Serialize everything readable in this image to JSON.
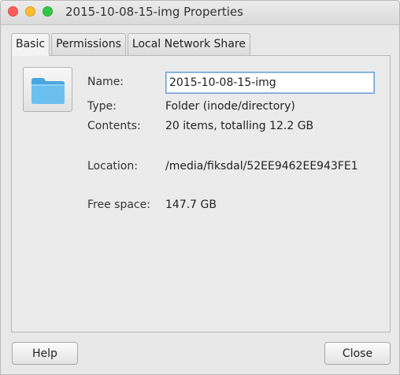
{
  "window": {
    "title": "2015-10-08-15-img Properties"
  },
  "tabs": [
    {
      "label": "Basic",
      "active": true
    },
    {
      "label": "Permissions",
      "active": false
    },
    {
      "label": "Local Network Share",
      "active": false
    }
  ],
  "basic": {
    "folder_icon": "folder-icon",
    "name_label": "Name:",
    "name_value": "2015-10-08-15-img",
    "type_label": "Type:",
    "type_value": "Folder (inode/directory)",
    "contents_label": "Contents:",
    "contents_value": "20 items, totalling 12.2 GB",
    "location_label": "Location:",
    "location_value": "/media/fiksdal/52EE9462EE943FE1",
    "free_label": "Free space:",
    "free_value": "147.7 GB"
  },
  "buttons": {
    "help": "Help",
    "close": "Close"
  },
  "colors": {
    "close_light": "#fc5f57",
    "minimize_light": "#fdbc2e",
    "maximize_light": "#33c748",
    "folder_blue": "#5fb6ea",
    "input_focus": "#6f9dd4"
  }
}
